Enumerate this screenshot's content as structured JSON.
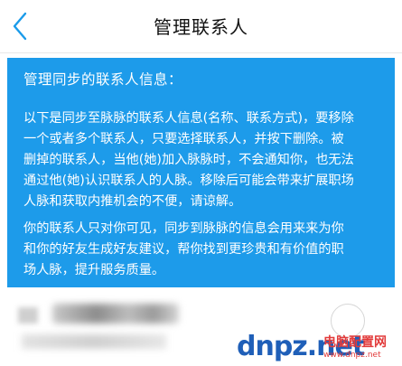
{
  "header": {
    "title": "管理联系人",
    "back_icon": "chevron-left-icon"
  },
  "info": {
    "heading": "管理同步的联系人信息：",
    "paragraph1": [
      "以下是同步至脉脉的联系人信息(名称、联系方式)，要移除",
      "一个或者多个联系人，只要选择联系人，并按下删除。被",
      "删掉的联系人，当他(她)加入脉脉时，不会通知你，也无法",
      "通过他(她)认识联系人的人脉。移除后可能会带来扩展职场",
      "人脉和获取内推机会的不便，请谅解。"
    ],
    "paragraph2": [
      "你的联系人只对你可见，同步到脉脉的信息会用来来为你",
      "和你的好友生成好友建议，帮你找到更珍贵和有价值的职",
      "场人脉，提升服务质量。"
    ]
  },
  "watermark": {
    "logo": "dnpz.net",
    "site_name": "电脑配置网",
    "url": "www.dnpz.net"
  },
  "colors": {
    "panel": "#1d9bea",
    "back": "#1a9bea"
  }
}
